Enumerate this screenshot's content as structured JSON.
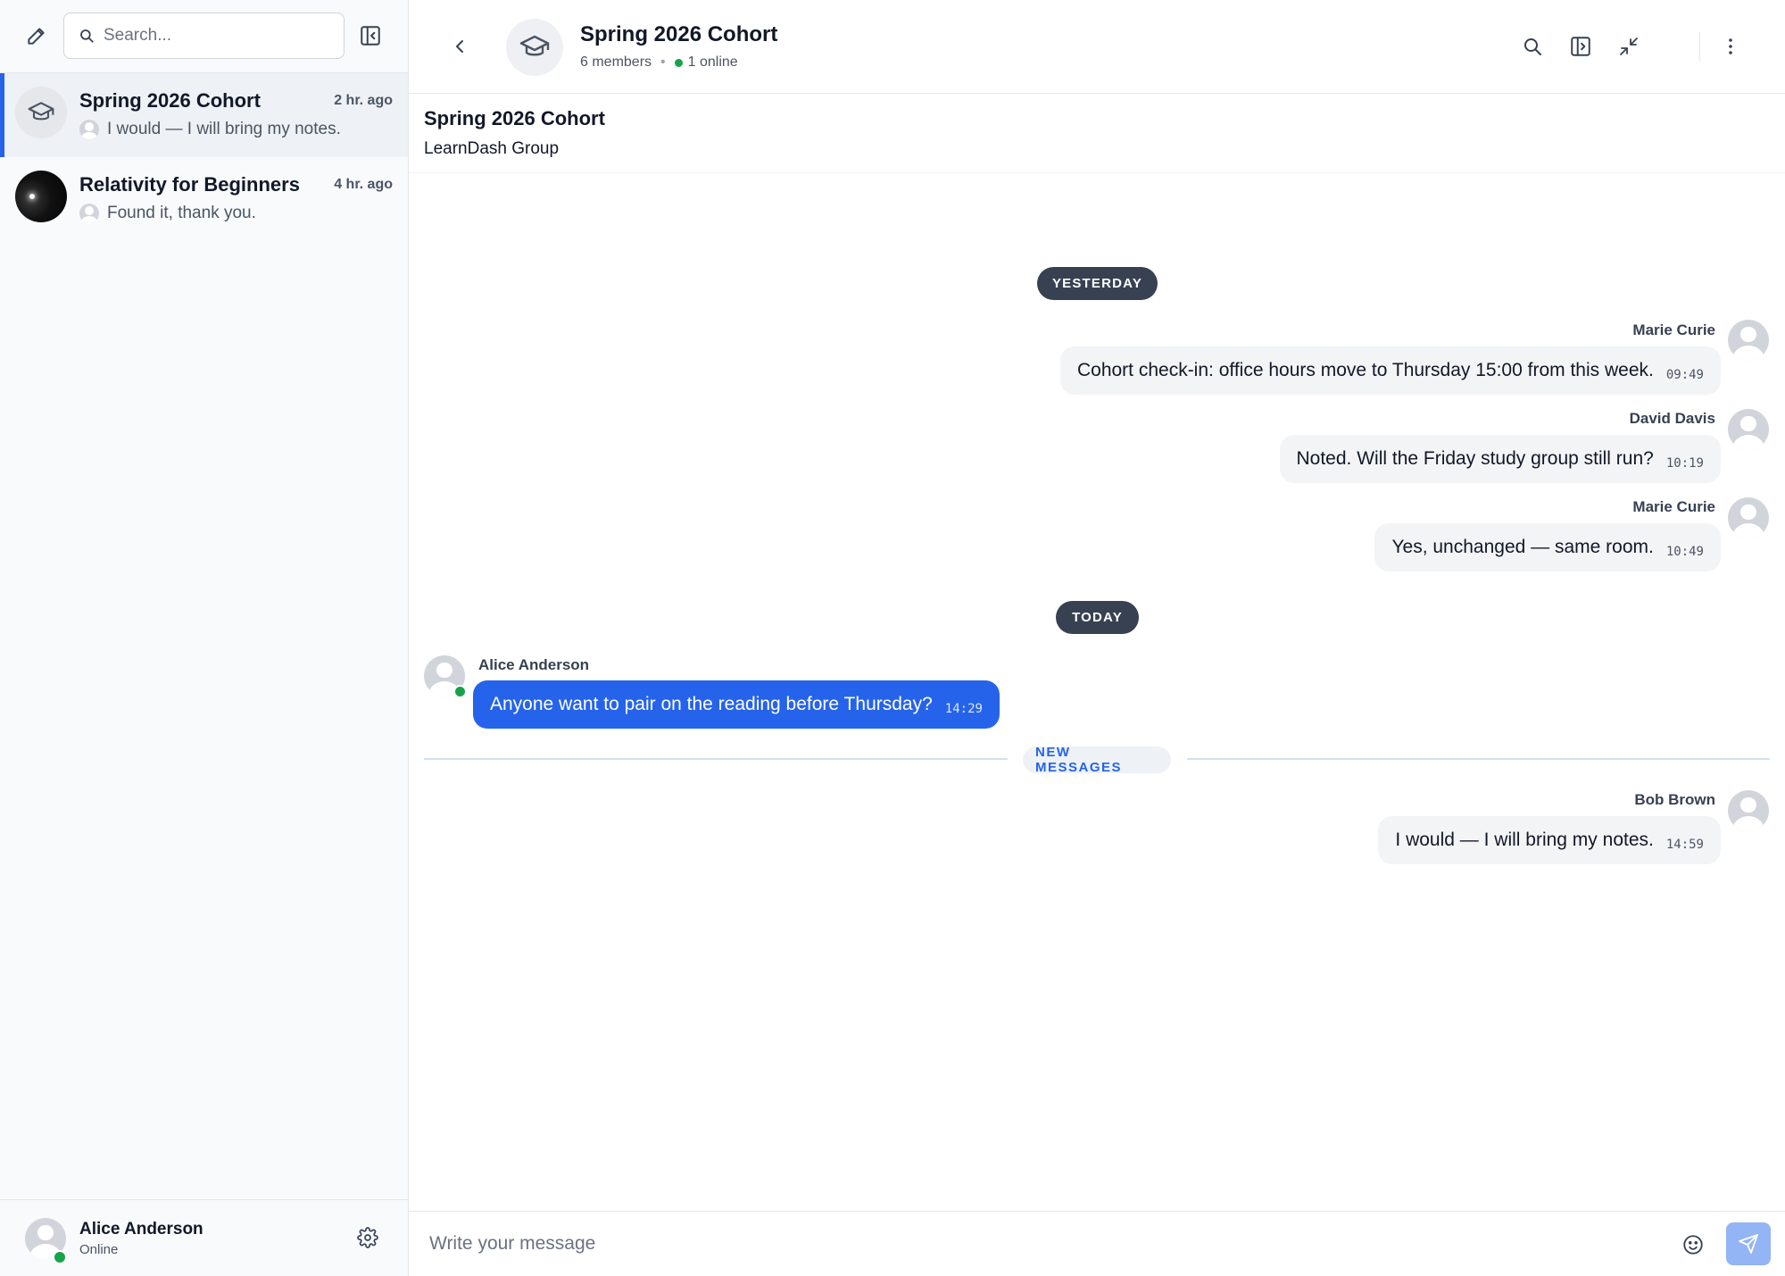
{
  "sidebar": {
    "search_placeholder": "Search...",
    "conversations": [
      {
        "title": "Spring 2026 Cohort",
        "time": "2 hr. ago",
        "preview": "I would — I will bring my notes.",
        "avatar_icon": "graduation-cap-icon",
        "active": true
      },
      {
        "title": "Relativity for Beginners",
        "time": "4 hr. ago",
        "preview": "Found it, thank you.",
        "avatar_icon": "space-image",
        "active": false
      }
    ],
    "user": {
      "name": "Alice Anderson",
      "status": "Online"
    }
  },
  "header": {
    "title": "Spring 2026 Cohort",
    "members": "6 members",
    "online": "1 online",
    "avatar_icon": "graduation-cap-icon"
  },
  "info": {
    "title": "Spring 2026 Cohort",
    "subtitle": "LearnDash Group"
  },
  "messages": {
    "day_yesterday": "YESTERDAY",
    "day_today": "TODAY",
    "new_messages": "NEW MESSAGES",
    "items": [
      {
        "sender": "Marie Curie",
        "text": "Cohort check-in: office hours move to Thursday 15:00 from this week.",
        "time": "09:49",
        "side": "right"
      },
      {
        "sender": "David Davis",
        "text": "Noted. Will the Friday study group still run?",
        "time": "10:19",
        "side": "right"
      },
      {
        "sender": "Marie Curie",
        "text": "Yes, unchanged — same room.",
        "time": "10:49",
        "side": "right"
      },
      {
        "sender": "Alice Anderson",
        "text": "Anyone want to pair on the reading before Thursday?",
        "time": "14:29",
        "side": "left"
      },
      {
        "sender": "Bob Brown",
        "text": "I would — I will bring my notes.",
        "time": "14:59",
        "side": "right"
      }
    ]
  },
  "composer": {
    "placeholder": "Write your message"
  },
  "colors": {
    "accent": "#2563eb",
    "online": "#16a34a",
    "day_pill": "#374151",
    "bubble": "#f3f4f6"
  }
}
